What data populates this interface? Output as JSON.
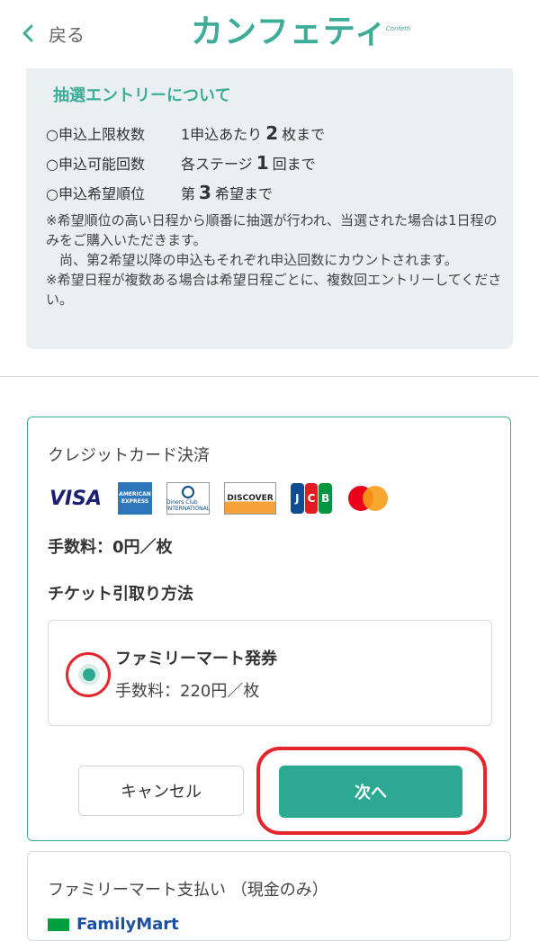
{
  "header": {
    "back_label": "戻る",
    "logo_text": "カンフェティ",
    "logo_sub": "Confetti"
  },
  "lottery_info": {
    "title": "抽選エントリーについて",
    "rows": [
      {
        "label": "○申込上限枚数",
        "prefix": "1申込あたり",
        "number": "2",
        "suffix": "枚まで"
      },
      {
        "label": "○申込可能回数",
        "prefix": "各ステージ",
        "number": "1",
        "suffix": "回まで"
      },
      {
        "label": "○申込希望順位",
        "prefix": "第",
        "number": "3",
        "suffix": "希望まで"
      }
    ],
    "notes": [
      "※希望順位の高い日程から順番に抽選が行われ、当選された場合は1日程のみをご購入いただきます。",
      "尚、第2希望以降の申込もそれぞれ申込回数にカウントされます。",
      "※希望日程が複数ある場合は希望日程ごとに、複数回エントリーしてください。"
    ]
  },
  "credit_card": {
    "title": "クレジットカード決済",
    "brands": [
      "VISA",
      "AMERICAN EXPRESS",
      "Diners Club INTERNATIONAL",
      "DISCOVER",
      "JCB",
      "mastercard"
    ],
    "brand_visa": "VISA",
    "brand_amex": "AMERICAN EXPRESS",
    "brand_diners": "Diners Club INTERNATIONAL",
    "brand_discover": "DISCOVER",
    "fee": "手数料：0円／枚",
    "pickup_title": "チケット引取り方法",
    "option": {
      "label": "ファミリーマート発券",
      "fee": "手数料：220円／枚",
      "selected": true
    },
    "cancel_label": "キャンセル",
    "next_label": "次へ"
  },
  "familymart_payment": {
    "title": "ファミリーマート支払い （現金のみ）",
    "logo_text": "FamilyMart"
  },
  "colors": {
    "accent": "#3dac98",
    "button": "#2da993",
    "highlight": "#e4252b"
  }
}
